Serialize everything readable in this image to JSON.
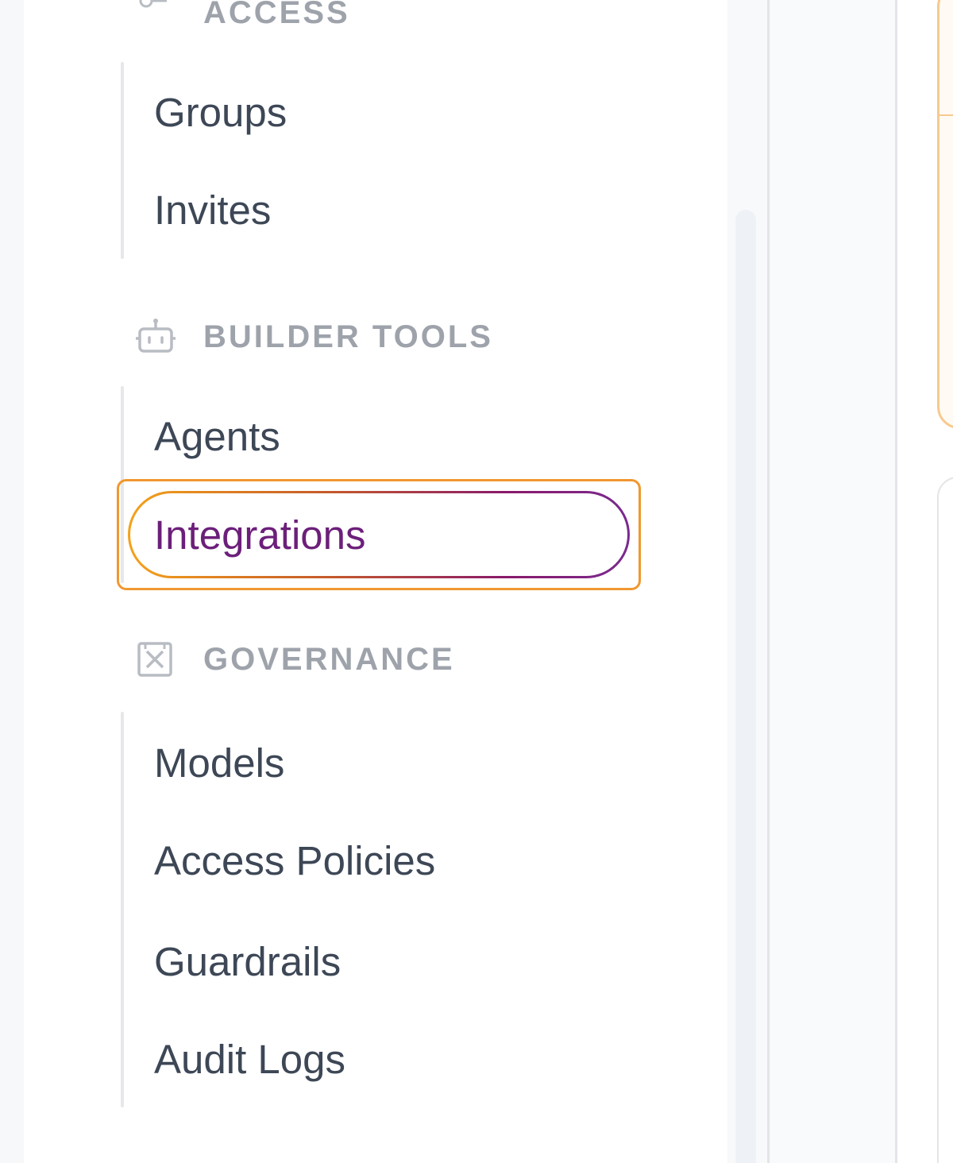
{
  "sidebar": {
    "sections": [
      {
        "label": "ACCESS",
        "icon": "key-icon",
        "items": [
          {
            "label": "Groups"
          },
          {
            "label": "Invites"
          }
        ]
      },
      {
        "label": "BUILDER TOOLS",
        "icon": "robot-icon",
        "items": [
          {
            "label": "Agents"
          },
          {
            "label": "Integrations",
            "active": true
          }
        ]
      },
      {
        "label": "GOVERNANCE",
        "icon": "shield-box-icon",
        "items": [
          {
            "label": "Models"
          },
          {
            "label": "Access Policies"
          },
          {
            "label": "Guardrails"
          },
          {
            "label": "Audit Logs"
          }
        ]
      }
    ]
  },
  "colors": {
    "section_label": "#9ea3ab",
    "item_text": "#3d4756",
    "active_text": "#6c1f7a",
    "active_gradient_start": "#f4a21a",
    "active_gradient_end": "#7a2a90",
    "focus_ring": "#f0982f",
    "guide_line": "#e5e7eb"
  }
}
